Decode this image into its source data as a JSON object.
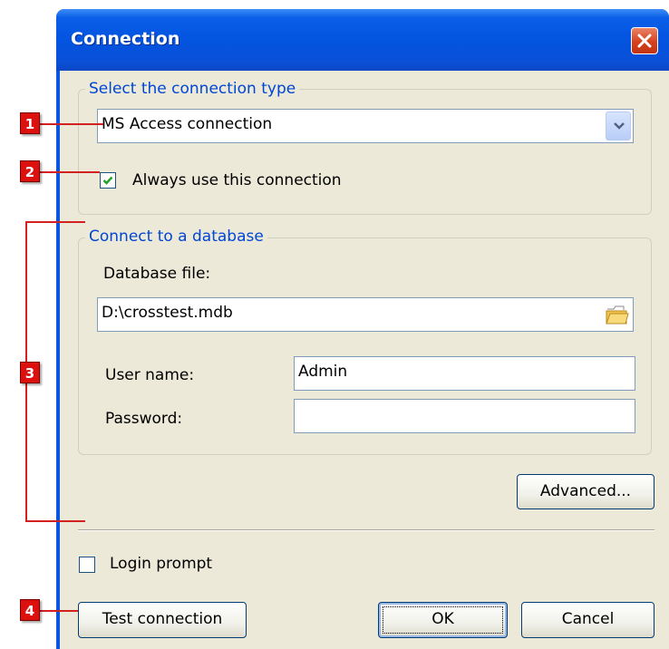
{
  "window": {
    "title": "Connection"
  },
  "connection_type": {
    "legend": "Select the connection type",
    "selected": "MS Access connection",
    "always_use_label": "Always use this connection",
    "always_use_checked": true
  },
  "database": {
    "legend": "Connect to a database",
    "file_label": "Database file:",
    "file_value": "D:\\crosstest.mdb",
    "username_label": "User name:",
    "username_value": "Admin",
    "password_label": "Password:",
    "password_value": ""
  },
  "buttons": {
    "advanced": "Advanced...",
    "test_connection": "Test connection",
    "ok": "OK",
    "cancel": "Cancel"
  },
  "login_prompt": {
    "label": "Login prompt",
    "checked": false
  },
  "callouts": [
    "1",
    "2",
    "3",
    "4"
  ],
  "colors": {
    "titlebar": "#0354e0",
    "client": "#ece9d8",
    "legend": "#0046d5",
    "callout": "#dd1010"
  },
  "icons": {
    "close": "close-icon",
    "dropdown": "chevron-down-icon",
    "browse": "folder-icon",
    "check": "check-icon"
  }
}
